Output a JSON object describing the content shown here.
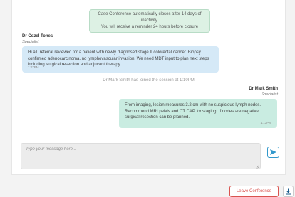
{
  "notice": {
    "line1": "Case Conference automatically closes after 14 days of inactivity.",
    "line2": "You will receive a reminder 24 hours before closure"
  },
  "messages": [
    {
      "sender": "Dr Cozel Tones",
      "role": "Specialist",
      "text": "Hi all, referral reviewed for a patient with newly diagnosed stage II colorectal cancer. Biopsy confirmed adenocarcinoma, no lymphovascular invasion. We need MDT input to plan next steps including surgical resection and adjuvant therapy.",
      "time": "1:07PM"
    },
    {
      "sender": "Dr Mark Smith",
      "role": "Specialist",
      "text": "From imaging, lesion measures 3.2 cm with no suspicious lymph nodes. Recommend MRI pelvis and CT CAP for staging. If nodes are negative, surgical resection can be planned.",
      "time": "1:13PM"
    }
  ],
  "system_message": "Dr Mark Smith has joined the session at 1:10PM",
  "compose": {
    "placeholder": "Type your message here..."
  },
  "actions": {
    "leave_label": "Leave Conference"
  },
  "colors": {
    "accent": "#3399cc",
    "danger": "#d9534f",
    "incoming_bubble": "#d5e9f7",
    "outgoing_bubble": "#c9ece1",
    "notice_bg": "#ddf1e4"
  },
  "icons": {
    "send": "send-arrow-icon",
    "download": "download-icon",
    "resize": "resize-grip-icon"
  }
}
